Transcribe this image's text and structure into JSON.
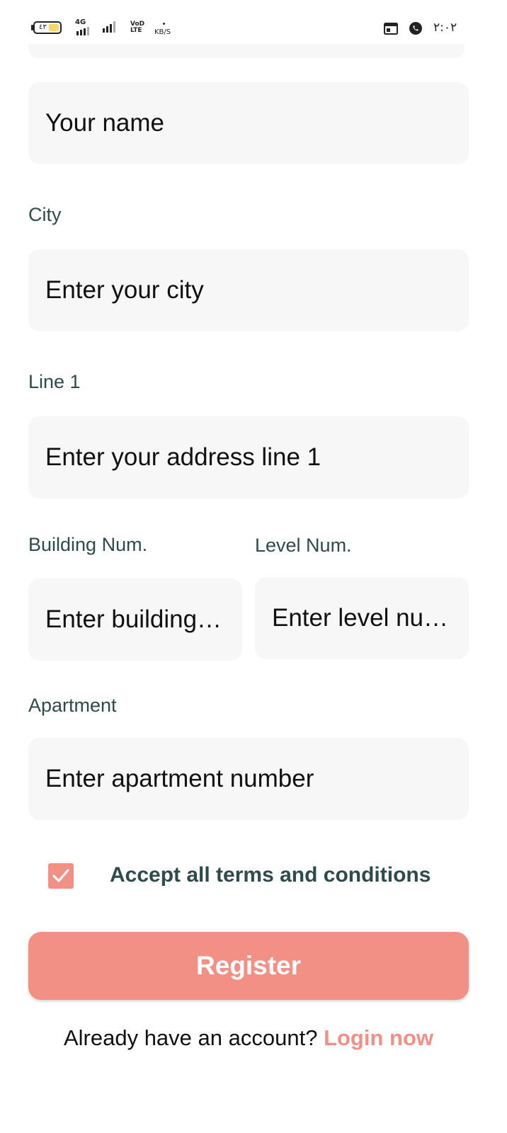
{
  "status_bar": {
    "battery_level": "٤٣",
    "network_type": "4G",
    "volte_line1": "VoD",
    "volte_line2": "LTE",
    "speed_unit": "KB/S",
    "time": "٢:٠٢",
    "icons": [
      "calendar-icon",
      "whatsapp-icon"
    ]
  },
  "form": {
    "name_field": {
      "value": "Your name"
    },
    "city": {
      "label": "City",
      "placeholder": "Enter your city"
    },
    "line1": {
      "label": "Line 1",
      "placeholder": "Enter your address line 1"
    },
    "building": {
      "label": "Building Num.",
      "placeholder": "Enter building…"
    },
    "level": {
      "label": "Level Num.",
      "placeholder": "Enter level nu…"
    },
    "apartment": {
      "label": "Apartment",
      "placeholder": "Enter apartment number"
    },
    "terms": {
      "label": "Accept all terms and conditions",
      "checked": true
    },
    "register_label": "Register",
    "login_prompt": "Already have an account?",
    "login_link": "Login now"
  },
  "colors": {
    "accent": "#f29086",
    "field_background": "#f7f7f7",
    "label_text": "#2e4a4a"
  }
}
